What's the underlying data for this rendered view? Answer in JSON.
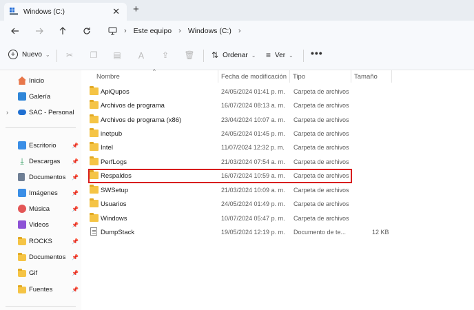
{
  "window": {
    "tab_title": "Windows (C:)",
    "new_tab": "+",
    "close": "✕"
  },
  "address": {
    "crumbs": [
      "Este equipo",
      "Windows (C:)"
    ]
  },
  "toolbar": {
    "new_label": "Nuevo",
    "sort_label": "Ordenar",
    "view_label": "Ver",
    "more": "•••"
  },
  "sidebar": {
    "top": [
      {
        "label": "Inicio",
        "icon": "home-icon",
        "color": "#e8774a"
      },
      {
        "label": "Galería",
        "icon": "gallery-icon",
        "color": "#2f86d8"
      },
      {
        "label": "SAC - Personal",
        "icon": "cloud-icon",
        "color": "#1f6fd1"
      }
    ],
    "pinned": [
      {
        "label": "Escritorio",
        "icon": "desktop-icon",
        "color": "#3a8ee6"
      },
      {
        "label": "Descargas",
        "icon": "download-icon",
        "color": "#2e9b5e"
      },
      {
        "label": "Documentos",
        "icon": "documents-icon",
        "color": "#6f7f95"
      },
      {
        "label": "Imágenes",
        "icon": "pictures-icon",
        "color": "#3a8ee6"
      },
      {
        "label": "Música",
        "icon": "music-icon",
        "color": "#e35656"
      },
      {
        "label": "Videos",
        "icon": "videos-icon",
        "color": "#8d52d6"
      },
      {
        "label": "ROCKS",
        "icon": "folder-icon",
        "color": "#f5c445"
      },
      {
        "label": "Documentos",
        "icon": "folder-icon",
        "color": "#f5c445"
      },
      {
        "label": "Gif",
        "icon": "folder-icon",
        "color": "#f5c445"
      },
      {
        "label": "Fuentes",
        "icon": "folder-icon",
        "color": "#f5c445"
      }
    ]
  },
  "columns": {
    "name": "Nombre",
    "date": "Fecha de modificación",
    "type": "Tipo",
    "size": "Tamaño"
  },
  "files": [
    {
      "name": "ApiQupos",
      "date": "24/05/2024 01:41 p. m.",
      "type": "Carpeta de archivos",
      "size": "",
      "kind": "folder"
    },
    {
      "name": "Archivos de programa",
      "date": "16/07/2024 08:13 a. m.",
      "type": "Carpeta de archivos",
      "size": "",
      "kind": "folder"
    },
    {
      "name": "Archivos de programa (x86)",
      "date": "23/04/2024 10:07 a. m.",
      "type": "Carpeta de archivos",
      "size": "",
      "kind": "folder"
    },
    {
      "name": "inetpub",
      "date": "24/05/2024 01:45 p. m.",
      "type": "Carpeta de archivos",
      "size": "",
      "kind": "folder"
    },
    {
      "name": "Intel",
      "date": "11/07/2024 12:32 p. m.",
      "type": "Carpeta de archivos",
      "size": "",
      "kind": "folder"
    },
    {
      "name": "PerfLogs",
      "date": "21/03/2024 07:54 a. m.",
      "type": "Carpeta de archivos",
      "size": "",
      "kind": "folder"
    },
    {
      "name": "Respaldos",
      "date": "16/07/2024 10:59 a. m.",
      "type": "Carpeta de archivos",
      "size": "",
      "kind": "folder"
    },
    {
      "name": "SWSetup",
      "date": "21/03/2024 10:09 a. m.",
      "type": "Carpeta de archivos",
      "size": "",
      "kind": "folder"
    },
    {
      "name": "Usuarios",
      "date": "24/05/2024 01:49 p. m.",
      "type": "Carpeta de archivos",
      "size": "",
      "kind": "folder"
    },
    {
      "name": "Windows",
      "date": "10/07/2024 05:47 p. m.",
      "type": "Carpeta de archivos",
      "size": "",
      "kind": "folder"
    },
    {
      "name": "DumpStack",
      "date": "19/05/2024 12:19 p. m.",
      "type": "Documento de te...",
      "size": "12 KB",
      "kind": "file"
    }
  ],
  "highlighted_item": "Respaldos",
  "colors": {
    "highlight_border": "#d81e1e",
    "folder": "#f5c445"
  }
}
